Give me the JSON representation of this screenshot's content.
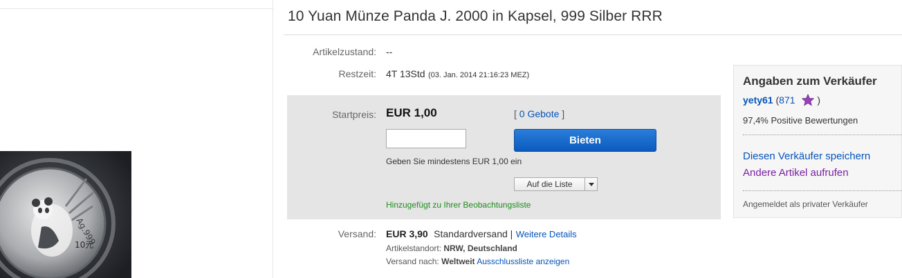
{
  "listing": {
    "title": "10 Yuan Münze Panda J. 2000 in Kapsel, 999 Silber RRR"
  },
  "details": {
    "condition_label": "Artikelzustand:",
    "condition_value": "--",
    "time_left_label": "Restzeit:",
    "time_left_value": "4T 13Std",
    "time_left_end": "(03. Jan. 2014  21:16:23 MEZ)"
  },
  "bid": {
    "start_price_label": "Startpreis:",
    "start_price": "EUR 1,00",
    "bids_open": "[",
    "bids_count": "0 Gebote",
    "bids_close": "]",
    "input_value": "",
    "button_label": "Bieten",
    "min_hint": "Geben Sie mindestens EUR 1,00 ein",
    "watch_label": "Auf die Liste",
    "watch_added": "Hinzugefügt zu Ihrer Beobachtungsliste"
  },
  "shipping": {
    "label": "Versand:",
    "price": "EUR 3,90",
    "method": "Standardversand |",
    "details_link": "Weitere Details",
    "location_label": "Artikelstandort:",
    "location_value": "NRW, Deutschland",
    "ships_to_label": "Versand nach:",
    "ships_to_value": "Weltweit",
    "exclusion_link": "Ausschlussliste anzeigen"
  },
  "seller": {
    "heading": "Angaben zum Verkäufer",
    "name": "yety61",
    "score_open": "(",
    "score": "871",
    "score_close": ")",
    "positive": "97,4% Positive Bewertungen",
    "save_link": "Diesen Verkäufer speichern",
    "other_items_link": "Andere Artikel aufrufen",
    "account_type": "Angemeldet als privater Verkäufer"
  },
  "icons": {
    "feedback_star": "purple-star-icon",
    "dropdown": "chevron-down-icon"
  },
  "colors": {
    "link": "#0654ba",
    "bid_button": "#0a5bbf",
    "visited_link": "#7b1fa2",
    "success": "#1e8b1e",
    "feedback_star": "#9c3fbf"
  }
}
